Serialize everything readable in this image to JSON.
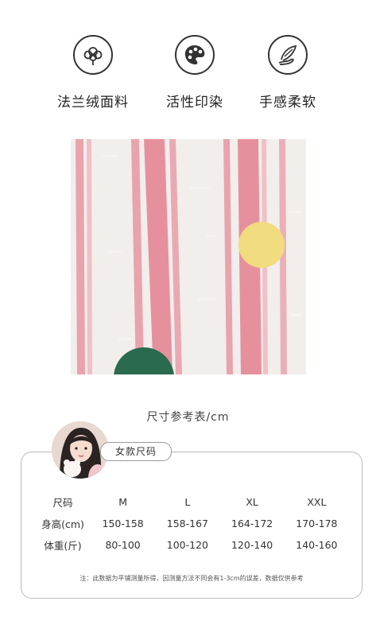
{
  "features": [
    {
      "icon": "cotton-icon",
      "label": "法兰绒面料"
    },
    {
      "icon": "palette-icon",
      "label": "活性印染"
    },
    {
      "icon": "feather-hand-icon",
      "label": "手感柔软"
    }
  ],
  "size_chart": {
    "title": "尺寸参考表/cm",
    "tag": "女款尺码",
    "header": [
      "尺码",
      "M",
      "L",
      "XL",
      "XXL"
    ],
    "rows": [
      [
        "身高(cm)",
        "150-158",
        "158-167",
        "164-172",
        "170-178"
      ],
      [
        "体重(斤)",
        "80-100",
        "100-120",
        "120-140",
        "140-160"
      ]
    ],
    "note": "注：此数据为平铺测量所得，因测量方法不同会有1-3cm的误差，数据仅供参考"
  }
}
